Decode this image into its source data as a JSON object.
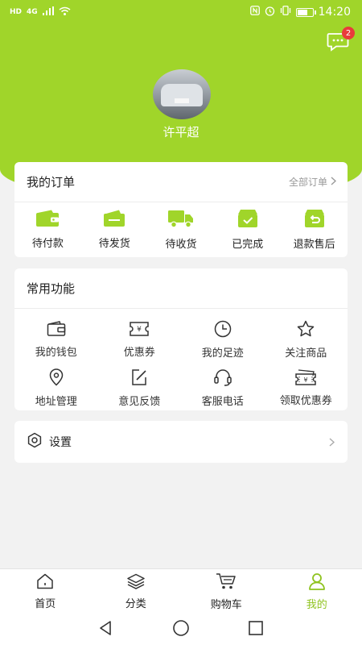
{
  "status_bar": {
    "network": "HD",
    "signal": "4G",
    "time": "14:20"
  },
  "header": {
    "message_badge": "2",
    "username": "许平超"
  },
  "orders": {
    "title": "我的订单",
    "all_label": "全部订单",
    "items": [
      {
        "label": "待付款",
        "icon": "wallet-icon"
      },
      {
        "label": "待发货",
        "icon": "package-icon"
      },
      {
        "label": "待收货",
        "icon": "truck-icon"
      },
      {
        "label": "已完成",
        "icon": "completed-box-icon"
      },
      {
        "label": "退款售后",
        "icon": "return-icon"
      }
    ]
  },
  "functions": {
    "title": "常用功能",
    "items": [
      {
        "label": "我的钱包",
        "icon": "wallet-outline-icon"
      },
      {
        "label": "优惠券",
        "icon": "coupon-icon"
      },
      {
        "label": "我的足迹",
        "icon": "clock-icon"
      },
      {
        "label": "关注商品",
        "icon": "star-icon"
      },
      {
        "label": "地址管理",
        "icon": "location-pin-icon"
      },
      {
        "label": "意见反馈",
        "icon": "edit-icon"
      },
      {
        "label": "客服电话",
        "icon": "headset-icon"
      },
      {
        "label": "领取优惠券",
        "icon": "ticket-icon"
      }
    ]
  },
  "settings": {
    "label": "设置"
  },
  "tabs": [
    {
      "label": "首页",
      "icon": "home-icon"
    },
    {
      "label": "分类",
      "icon": "layers-icon"
    },
    {
      "label": "购物车",
      "icon": "cart-icon"
    },
    {
      "label": "我的",
      "icon": "user-icon"
    }
  ],
  "colors": {
    "accent": "#a0d52a",
    "active_tab": "#8fc31f",
    "badge": "#e93b3b"
  }
}
